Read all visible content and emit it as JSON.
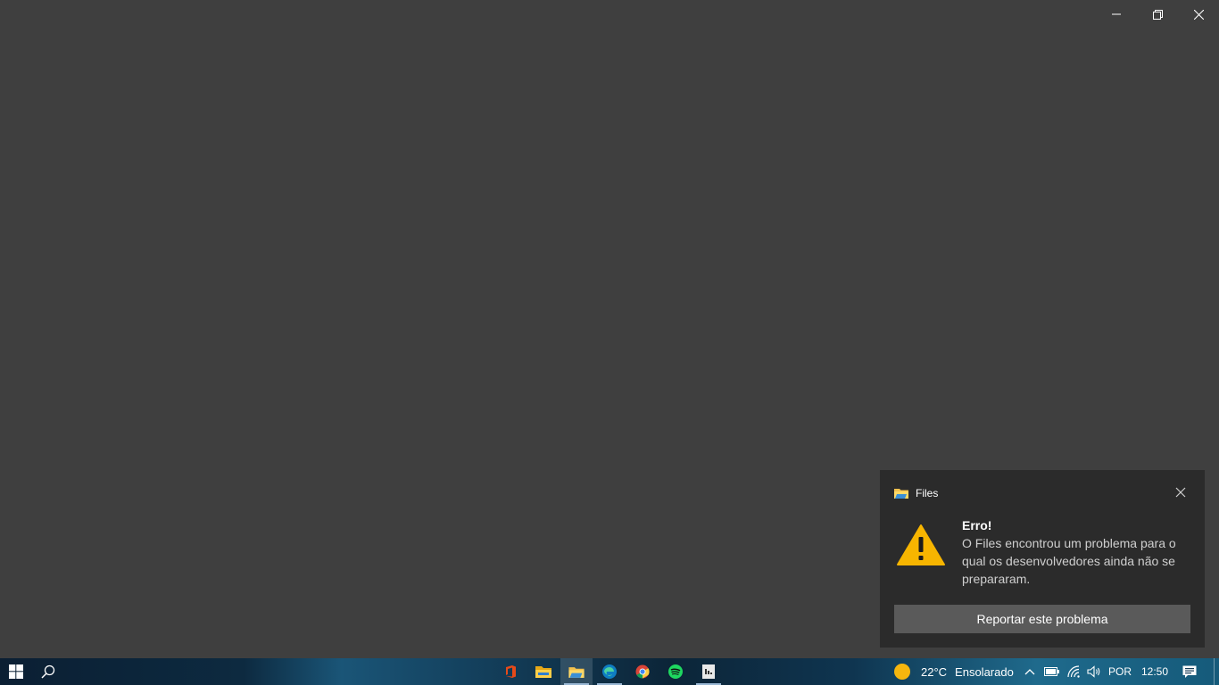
{
  "window": {
    "caption": {
      "minimize_icon": "minimize-icon",
      "restore_icon": "restore-icon",
      "close_icon": "close-icon"
    }
  },
  "toast": {
    "app_name": "Files",
    "title": "Erro!",
    "message": "O Files encontrou um problema para o qual os desenvolvedores ainda não se prepararam.",
    "action_label": "Reportar este problema",
    "icon": "warning-icon"
  },
  "taskbar": {
    "apps": [
      {
        "name": "office",
        "icon": "office-icon"
      },
      {
        "name": "file-explorer",
        "icon": "folder-icon"
      },
      {
        "name": "files",
        "icon": "files-app-icon",
        "active": true
      },
      {
        "name": "edge",
        "icon": "edge-icon"
      },
      {
        "name": "chrome",
        "icon": "chrome-icon"
      },
      {
        "name": "spotify",
        "icon": "spotify-icon"
      },
      {
        "name": "notepad-app",
        "icon": "notepad-icon"
      }
    ],
    "weather": {
      "temperature": "22°C",
      "condition": "Ensolarado"
    },
    "language": "POR",
    "time": "12:50"
  },
  "colors": {
    "window_bg": "#3f3f3f",
    "toast_bg": "#2b2b2b",
    "toast_button": "#5a5a5a",
    "warning": "#f7b500"
  }
}
